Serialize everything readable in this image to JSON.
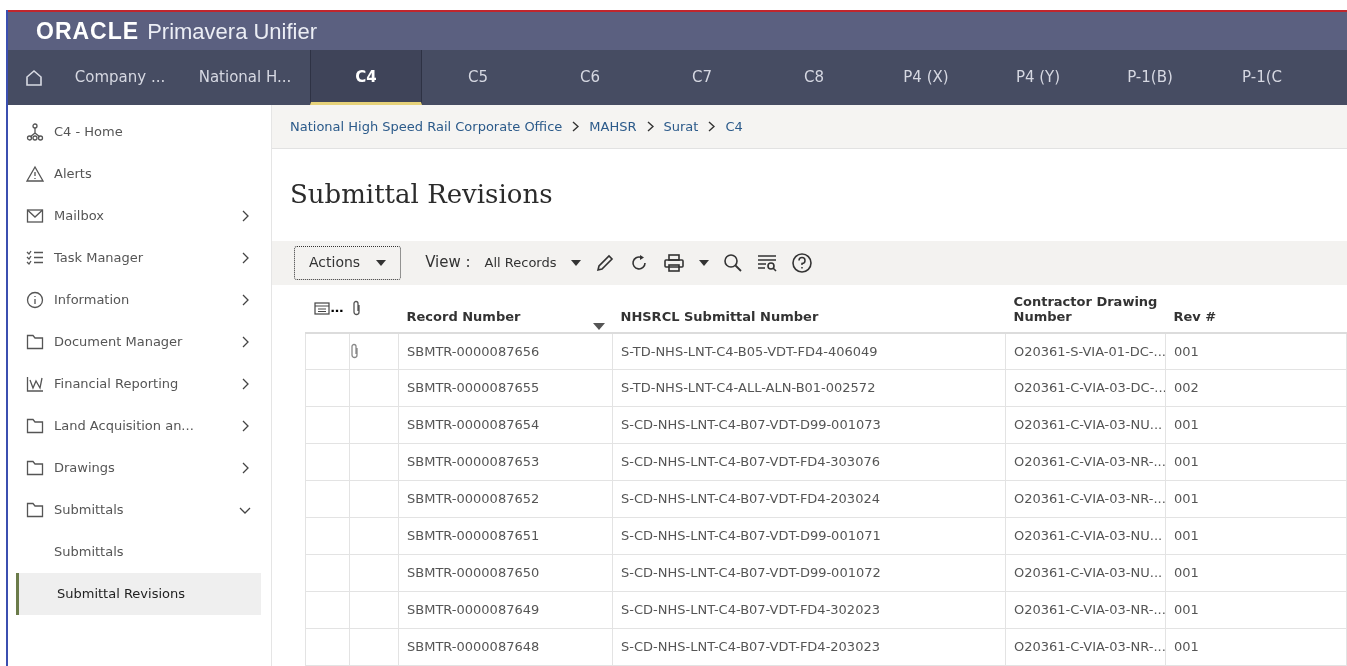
{
  "header": {
    "brand": "ORACLE",
    "product": "Primavera Unifier"
  },
  "tabs": [
    {
      "label": "Company ...",
      "selected": false
    },
    {
      "label": "National H...",
      "selected": false
    },
    {
      "label": "C4",
      "selected": true
    },
    {
      "label": "C5",
      "selected": false
    },
    {
      "label": "C6",
      "selected": false
    },
    {
      "label": "C7",
      "selected": false
    },
    {
      "label": "C8",
      "selected": false
    },
    {
      "label": "P4 (X)",
      "selected": false
    },
    {
      "label": "P4 (Y)",
      "selected": false
    },
    {
      "label": "P-1(B)",
      "selected": false
    },
    {
      "label": "P-1(C",
      "selected": false
    }
  ],
  "sidebar": {
    "items": [
      {
        "label": "C4 - Home",
        "kind": "home",
        "selected": false
      },
      {
        "label": "Alerts",
        "kind": "alert",
        "selected": false
      },
      {
        "label": "Mailbox",
        "kind": "mail",
        "expanded": false,
        "selected": false
      },
      {
        "label": "Task Manager",
        "kind": "tasks",
        "expanded": false,
        "selected": false
      },
      {
        "label": "Information",
        "kind": "info",
        "expanded": false,
        "selected": false
      },
      {
        "label": "Document Manager",
        "kind": "folder",
        "expanded": false,
        "selected": false
      },
      {
        "label": "Financial Reporting",
        "kind": "chart",
        "expanded": false,
        "selected": false
      },
      {
        "label": "Land Acquisition an...",
        "kind": "folder",
        "expanded": false,
        "selected": false
      },
      {
        "label": "Drawings",
        "kind": "folder",
        "expanded": false,
        "selected": false
      },
      {
        "label": "Submittals",
        "kind": "folder",
        "expanded": true,
        "selected": false
      },
      {
        "label": "Submittals",
        "kind": "sub",
        "selected": false
      },
      {
        "label": "Submittal Revisions",
        "kind": "sub",
        "selected": true
      }
    ]
  },
  "breadcrumb": [
    "National High Speed Rail Corporate Office",
    "MAHSR",
    "Surat",
    "C4"
  ],
  "page_title": "Submittal Revisions",
  "toolbar": {
    "actions": "Actions",
    "view_label": "View :",
    "view_value": "All Records"
  },
  "table": {
    "icon_column_label": "…",
    "columns": [
      "Record Number",
      "NHSRCL Submittal Number",
      "Contractor Drawing Number",
      "Rev #"
    ],
    "rows": [
      {
        "attachment": true,
        "cells": [
          "SBMTR-0000087656",
          "S-TD-NHS-LNT-C4-B05-VDT-FD4-406049",
          "O20361-S-VIA-01-DC-...",
          "001"
        ]
      },
      {
        "attachment": false,
        "cells": [
          "SBMTR-0000087655",
          "S-TD-NHS-LNT-C4-ALL-ALN-B01-002572",
          "O20361-C-VIA-03-DC-...",
          "002"
        ]
      },
      {
        "attachment": false,
        "cells": [
          "SBMTR-0000087654",
          "S-CD-NHS-LNT-C4-B07-VDT-D99-001073",
          "O20361-C-VIA-03-NU...",
          "001"
        ]
      },
      {
        "attachment": false,
        "cells": [
          "SBMTR-0000087653",
          "S-CD-NHS-LNT-C4-B07-VDT-FD4-303076",
          "O20361-C-VIA-03-NR-...",
          "001"
        ]
      },
      {
        "attachment": false,
        "cells": [
          "SBMTR-0000087652",
          "S-CD-NHS-LNT-C4-B07-VDT-FD4-203024",
          "O20361-C-VIA-03-NR-...",
          "001"
        ]
      },
      {
        "attachment": false,
        "cells": [
          "SBMTR-0000087651",
          "S-CD-NHS-LNT-C4-B07-VDT-D99-001071",
          "O20361-C-VIA-03-NU...",
          "001"
        ]
      },
      {
        "attachment": false,
        "cells": [
          "SBMTR-0000087650",
          "S-CD-NHS-LNT-C4-B07-VDT-D99-001072",
          "O20361-C-VIA-03-NU...",
          "001"
        ]
      },
      {
        "attachment": false,
        "cells": [
          "SBMTR-0000087649",
          "S-CD-NHS-LNT-C4-B07-VDT-FD4-302023",
          "O20361-C-VIA-03-NR-...",
          "001"
        ]
      },
      {
        "attachment": false,
        "cells": [
          "SBMTR-0000087648",
          "S-CD-NHS-LNT-C4-B07-VDT-FD4-203023",
          "O20361-C-VIA-03-NR-...",
          "001"
        ]
      }
    ]
  }
}
